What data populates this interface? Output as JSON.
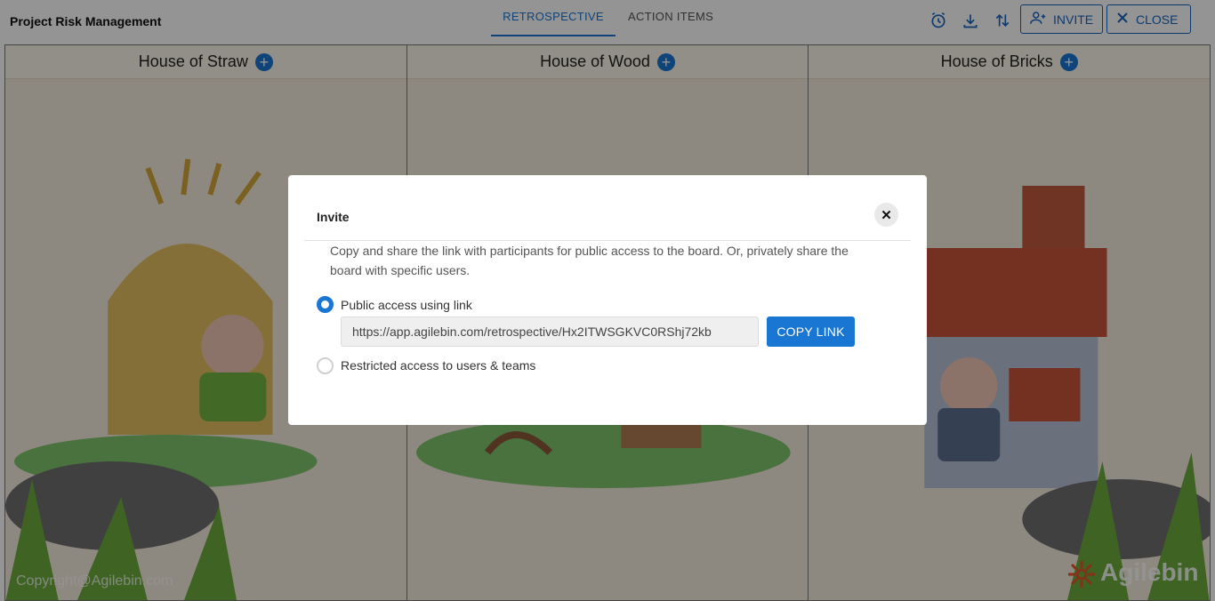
{
  "header": {
    "app_title": "Project Risk Management",
    "tabs": [
      {
        "label": "RETROSPECTIVE",
        "active": true
      },
      {
        "label": "ACTION ITEMS",
        "active": false
      }
    ],
    "icons": [
      "alarm-clock-icon",
      "download-icon",
      "sort-icon"
    ],
    "invite_label": "INVITE",
    "close_label": "CLOSE"
  },
  "board": {
    "columns": [
      {
        "title": "House of Straw"
      },
      {
        "title": "House of Wood"
      },
      {
        "title": "House of Bricks"
      }
    ],
    "copyright": "Copyright@Agilebin.com",
    "logo_text": "Agilebin"
  },
  "modal": {
    "title": "Invite",
    "description": "Copy and share the link with participants for public access to the board. Or, privately share the board with specific users.",
    "options": [
      {
        "label": "Public access using link",
        "selected": true
      },
      {
        "label": "Restricted access to users & teams",
        "selected": false
      }
    ],
    "link_value": "https://app.agilebin.com/retrospective/Hx2ITWSGKVC0RShj72kb",
    "copy_button": "COPY LINK"
  },
  "colors": {
    "accent": "#1976d2",
    "overlay": "rgba(0,0,0,0.42)"
  }
}
